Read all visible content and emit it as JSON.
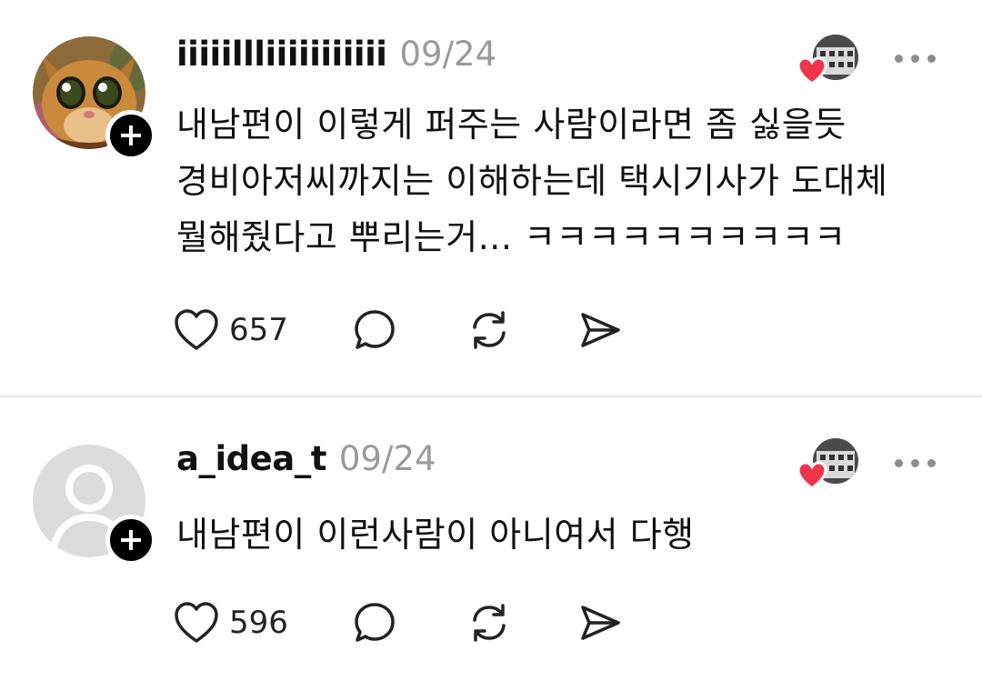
{
  "posts": [
    {
      "username": "iiiiillliiiiiiiiiii",
      "date": "09/24",
      "lines": [
        "내남편이 이렇게 퍼주는 사람이라면 좀 싫을듯",
        "경비아저씨까지는 이해하는데 택시기사가 도대체",
        "뭘해줬다고 뿌리는거... ㅋㅋㅋㅋㅋㅋㅋㅋㅋㅋ"
      ],
      "likes": "657",
      "avatar_icon": "cat-avatar-icon"
    },
    {
      "username": "a_idea_t",
      "date": "09/24",
      "lines": [
        "내남편이 이런사람이 아니여서 다행"
      ],
      "likes": "596",
      "avatar_icon": "default-avatar-icon"
    }
  ],
  "icons": {
    "follow": "plus-icon",
    "liked_by": "heart-icon",
    "more": "more-dots-icon",
    "like": "heart-outline-icon",
    "reply": "comment-bubble-icon",
    "repost": "repost-icon",
    "share": "send-icon"
  },
  "colors": {
    "text": "#111111",
    "date": "#9a9a9a",
    "heart_badge": "#f0344a",
    "divider": "#e6e6e6"
  }
}
